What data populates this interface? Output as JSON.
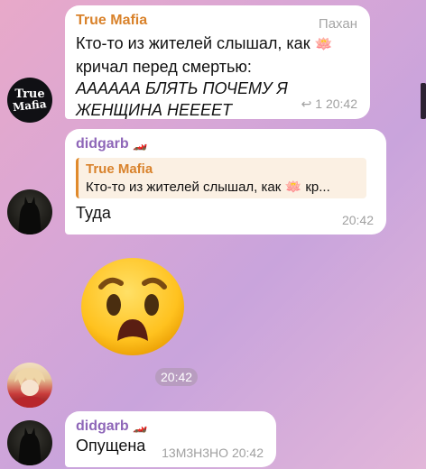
{
  "messages": [
    {
      "sender": "True Mafia",
      "role": "Пахан",
      "lines": [
        "Кто-то из жителей слышал, как",
        "кричал перед смертью:"
      ],
      "italic_lines": [
        "АААААА БЛЯТЬ ПОЧЕМУ Я",
        "ЖЕНЩИНА НЕЕЕЕТ"
      ],
      "replies": "1",
      "time": "20:42",
      "avatar_text": [
        "True",
        "Mafia"
      ]
    },
    {
      "sender": "didgarb",
      "quote_name": "True Mafia",
      "quote_text": "Кто-то из жителей слышал, как",
      "quote_suffix": "кр...",
      "text": "Туда",
      "time": "20:42"
    },
    {
      "type": "sticker",
      "time": "20:42"
    },
    {
      "sender": "didgarb",
      "text": "Опущена",
      "time": "20:42",
      "extra": "13M3H3HO"
    }
  ]
}
